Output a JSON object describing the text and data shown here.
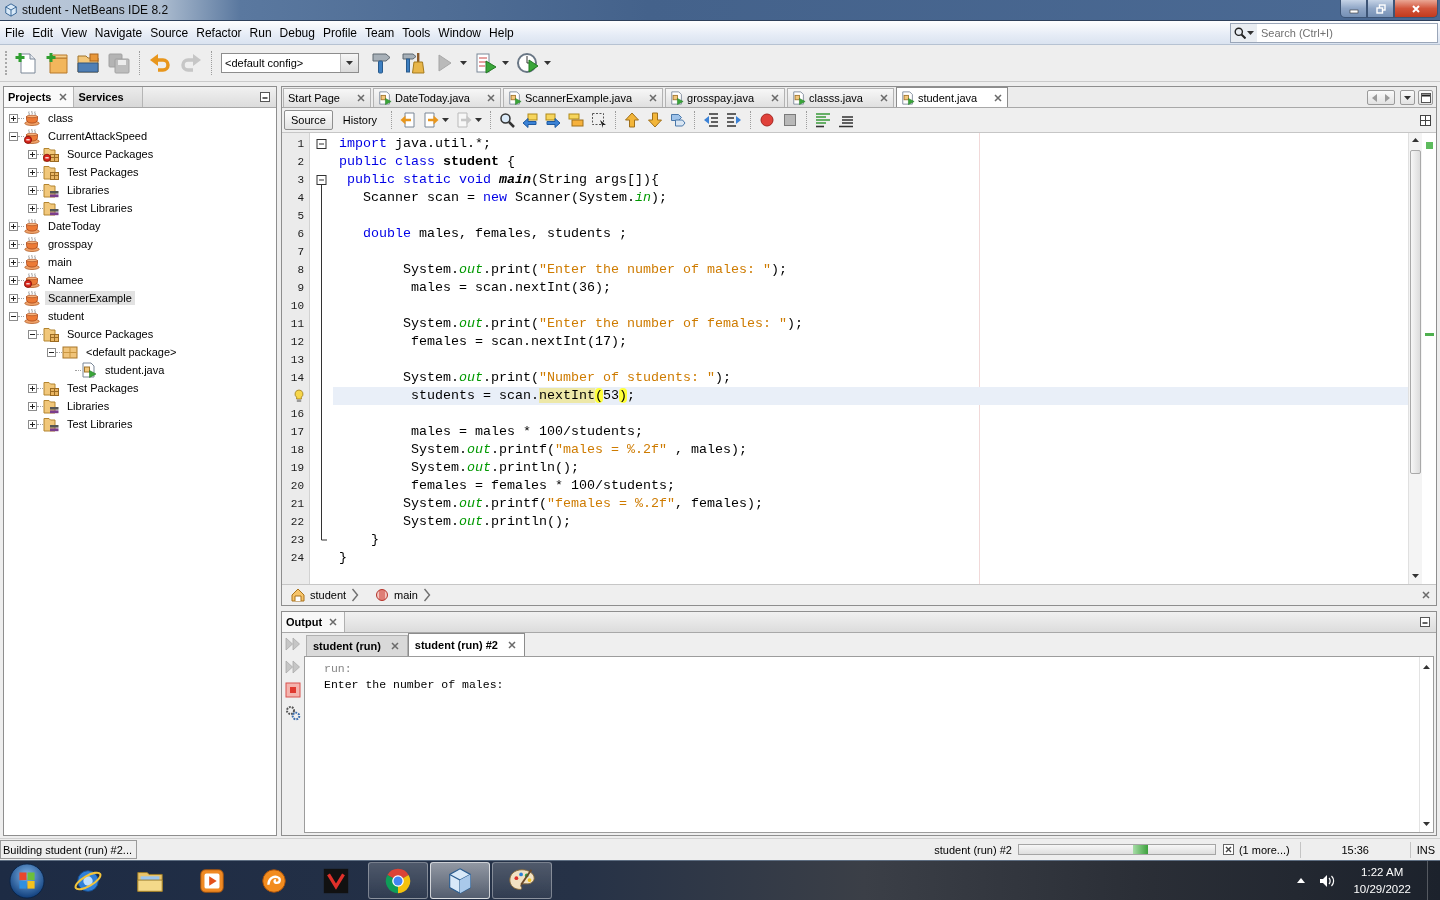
{
  "window": {
    "title": "student - NetBeans IDE 8.2"
  },
  "menu": [
    "File",
    "Edit",
    "View",
    "Navigate",
    "Source",
    "Refactor",
    "Run",
    "Debug",
    "Profile",
    "Team",
    "Tools",
    "Window",
    "Help"
  ],
  "search": {
    "placeholder": "Search (Ctrl+I)"
  },
  "toolbar": {
    "groups": [
      [
        {
          "kind": "new-file",
          "disabled": false
        },
        {
          "kind": "new-project",
          "disabled": false
        },
        {
          "kind": "open-project",
          "disabled": false
        },
        {
          "kind": "save-all",
          "disabled": true
        }
      ],
      [
        {
          "kind": "undo",
          "disabled": false
        },
        {
          "kind": "redo",
          "disabled": true
        }
      ]
    ],
    "config": "<default config>",
    "run_group": [
      {
        "kind": "build",
        "disabled": false,
        "dropdown": false
      },
      {
        "kind": "clean-build",
        "disabled": false,
        "dropdown": false
      },
      {
        "kind": "run",
        "disabled": true,
        "dropdown": true
      },
      {
        "kind": "debug",
        "disabled": false,
        "dropdown": true
      },
      {
        "kind": "profile",
        "disabled": false,
        "dropdown": true
      }
    ]
  },
  "projects": {
    "tabs": [
      {
        "label": "Projects",
        "selected": true
      },
      {
        "label": "Services",
        "selected": false
      }
    ],
    "tree": [
      {
        "label": "class",
        "kind": "project",
        "expanded": false,
        "selected": false,
        "error": false
      },
      {
        "label": "CurrentAttackSpeed",
        "kind": "project",
        "expanded": true,
        "selected": false,
        "error": true,
        "children": [
          {
            "label": "Source Packages",
            "kind": "source-packages",
            "expanded": false,
            "selected": false,
            "error": true
          },
          {
            "label": "Test Packages",
            "kind": "test-packages",
            "expanded": false,
            "selected": false,
            "error": false
          },
          {
            "label": "Libraries",
            "kind": "libraries",
            "expanded": false,
            "selected": false,
            "error": false
          },
          {
            "label": "Test Libraries",
            "kind": "test-libraries",
            "expanded": false,
            "selected": false,
            "error": false
          }
        ]
      },
      {
        "label": "DateToday",
        "kind": "project",
        "expanded": false,
        "selected": false,
        "error": false
      },
      {
        "label": "grosspay",
        "kind": "project",
        "expanded": false,
        "selected": false,
        "error": false
      },
      {
        "label": "main",
        "kind": "project",
        "expanded": false,
        "selected": false,
        "error": false
      },
      {
        "label": "Namee",
        "kind": "project",
        "expanded": false,
        "selected": false,
        "error": true
      },
      {
        "label": "ScannerExample",
        "kind": "project",
        "expanded": false,
        "selected": true,
        "error": false
      },
      {
        "label": "student",
        "kind": "project",
        "expanded": true,
        "selected": false,
        "error": false,
        "children": [
          {
            "label": "Source Packages",
            "kind": "source-packages",
            "expanded": true,
            "selected": false,
            "error": false,
            "children": [
              {
                "label": "<default package>",
                "kind": "package",
                "expanded": true,
                "selected": false,
                "error": false,
                "children": [
                  {
                    "label": "student.java",
                    "kind": "java-file",
                    "selected": false,
                    "error": false
                  }
                ]
              }
            ]
          },
          {
            "label": "Test Packages",
            "kind": "test-packages",
            "expanded": false,
            "selected": false,
            "error": false
          },
          {
            "label": "Libraries",
            "kind": "libraries",
            "expanded": false,
            "selected": false,
            "error": false
          },
          {
            "label": "Test Libraries",
            "kind": "test-libraries",
            "expanded": false,
            "selected": false,
            "error": false
          }
        ]
      }
    ]
  },
  "editor": {
    "tabs": [
      {
        "label": "Start Page",
        "kind": "page",
        "selected": false
      },
      {
        "label": "DateToday.java",
        "kind": "java",
        "selected": false
      },
      {
        "label": "ScannerExample.java",
        "kind": "java",
        "selected": false
      },
      {
        "label": "grosspay.java",
        "kind": "java",
        "selected": false
      },
      {
        "label": "classs.java",
        "kind": "java",
        "selected": false
      },
      {
        "label": "student.java",
        "kind": "java",
        "selected": true
      }
    ],
    "views": [
      {
        "label": "Source",
        "selected": true
      },
      {
        "label": "History",
        "selected": false
      }
    ],
    "tools": [
      [
        {
          "kind": "back",
          "disabled": false,
          "dropdown": false
        },
        {
          "kind": "forward",
          "disabled": false,
          "dropdown": true
        },
        {
          "kind": "last-edit",
          "disabled": true,
          "dropdown": true
        }
      ],
      [
        {
          "kind": "find",
          "disabled": false,
          "dropdown": false
        },
        {
          "kind": "find-prev",
          "disabled": false,
          "dropdown": false
        },
        {
          "kind": "find-next",
          "disabled": false,
          "dropdown": false
        },
        {
          "kind": "highlight",
          "disabled": false,
          "dropdown": false
        },
        {
          "kind": "find-selection",
          "disabled": false,
          "dropdown": false
        }
      ],
      [
        {
          "kind": "bookmark-prev",
          "disabled": false,
          "dropdown": false
        },
        {
          "kind": "bookmark-next",
          "disabled": false,
          "dropdown": false
        },
        {
          "kind": "bookmark-toggle",
          "disabled": false,
          "dropdown": false
        }
      ],
      [
        {
          "kind": "shift-left",
          "disabled": false,
          "dropdown": false
        },
        {
          "kind": "shift-right",
          "disabled": false,
          "dropdown": false
        }
      ],
      [
        {
          "kind": "record",
          "disabled": false,
          "dropdown": false
        },
        {
          "kind": "stop",
          "disabled": false,
          "dropdown": false
        }
      ],
      [
        {
          "kind": "comment",
          "disabled": false,
          "dropdown": false
        },
        {
          "kind": "uncomment",
          "disabled": false,
          "dropdown": false
        }
      ]
    ],
    "lines": [
      {
        "number": "1",
        "hint": false,
        "current": false,
        "expanded": true,
        "tokens": [
          {
            "kind": "keyword",
            "text": "import"
          },
          {
            "kind": "plain",
            "text": " java.util.*;"
          }
        ]
      },
      {
        "number": "2",
        "hint": false,
        "current": false,
        "tokens": [
          {
            "kind": "keyword",
            "text": "public class"
          },
          {
            "kind": "declaration",
            "text": " student"
          },
          {
            "kind": "plain",
            "text": " {"
          }
        ]
      },
      {
        "number": "3",
        "hint": false,
        "current": false,
        "expanded": true,
        "tokens": [
          {
            "kind": "keyword",
            "text": " public static void"
          },
          {
            "kind": "static-method",
            "text": " main"
          },
          {
            "kind": "plain",
            "text": "(String args[]){"
          }
        ],
        "children": [
          {
            "number": "4",
            "hint": false,
            "current": false,
            "tokens": [
              {
                "kind": "plain",
                "text": "   Scanner scan = "
              },
              {
                "kind": "keyword",
                "text": "new"
              },
              {
                "kind": "plain",
                "text": " Scanner(System."
              },
              {
                "kind": "field",
                "text": "in"
              },
              {
                "kind": "plain",
                "text": ");"
              }
            ]
          },
          {
            "number": "5",
            "hint": false,
            "current": false
          },
          {
            "number": "6",
            "hint": false,
            "current": false,
            "tokens": [
              {
                "kind": "keyword",
                "text": "   double"
              },
              {
                "kind": "plain",
                "text": " males, females, students ;"
              }
            ]
          },
          {
            "number": "7",
            "hint": false,
            "current": false
          },
          {
            "number": "8",
            "hint": false,
            "current": false,
            "tokens": [
              {
                "kind": "plain",
                "text": "        System."
              },
              {
                "kind": "field",
                "text": "out"
              },
              {
                "kind": "plain",
                "text": ".print("
              },
              {
                "kind": "string",
                "text": "\"Enter the number of males: \""
              },
              {
                "kind": "plain",
                "text": ");"
              }
            ]
          },
          {
            "number": "9",
            "hint": false,
            "current": false,
            "tokens": [
              {
                "kind": "plain",
                "text": "         males = scan.nextInt(36);"
              }
            ]
          },
          {
            "number": "10",
            "hint": false,
            "current": false
          },
          {
            "number": "11",
            "hint": false,
            "current": false,
            "tokens": [
              {
                "kind": "plain",
                "text": "        System."
              },
              {
                "kind": "field",
                "text": "out"
              },
              {
                "kind": "plain",
                "text": ".print("
              },
              {
                "kind": "string",
                "text": "\"Enter the number of females: \""
              },
              {
                "kind": "plain",
                "text": ");"
              }
            ]
          },
          {
            "number": "12",
            "hint": false,
            "current": false,
            "tokens": [
              {
                "kind": "plain",
                "text": "         females = scan.nextInt(17);"
              }
            ]
          },
          {
            "number": "13",
            "hint": false,
            "current": false
          },
          {
            "number": "14",
            "hint": false,
            "current": false,
            "tokens": [
              {
                "kind": "plain",
                "text": "        System."
              },
              {
                "kind": "field",
                "text": "out"
              },
              {
                "kind": "plain",
                "text": ".print("
              },
              {
                "kind": "string",
                "text": "\"Number of students: \""
              },
              {
                "kind": "plain",
                "text": ");"
              }
            ]
          },
          {
            "hint": true,
            "current": true,
            "tokens": [
              {
                "kind": "plain",
                "text": "         students = scan."
              },
              {
                "kind": "occurrence",
                "text": "nextInt"
              },
              {
                "kind": "bracket",
                "text": "("
              },
              {
                "kind": "plain",
                "text": "53"
              },
              {
                "kind": "bracket",
                "text": ")"
              },
              {
                "kind": "plain",
                "text": ";"
              }
            ]
          },
          {
            "number": "16",
            "hint": false,
            "current": false
          },
          {
            "number": "17",
            "hint": false,
            "current": false,
            "tokens": [
              {
                "kind": "plain",
                "text": "         males = males * 100/students;"
              }
            ]
          },
          {
            "number": "18",
            "hint": false,
            "current": false,
            "tokens": [
              {
                "kind": "plain",
                "text": "         System."
              },
              {
                "kind": "field",
                "text": "out"
              },
              {
                "kind": "plain",
                "text": ".printf("
              },
              {
                "kind": "string",
                "text": "\"males = %.2f\""
              },
              {
                "kind": "plain",
                "text": " , males);"
              }
            ]
          },
          {
            "number": "19",
            "hint": false,
            "current": false,
            "tokens": [
              {
                "kind": "plain",
                "text": "         System."
              },
              {
                "kind": "field",
                "text": "out"
              },
              {
                "kind": "plain",
                "text": ".println();"
              }
            ]
          },
          {
            "number": "20",
            "hint": false,
            "current": false,
            "tokens": [
              {
                "kind": "plain",
                "text": "         females = females * 100/students;"
              }
            ]
          },
          {
            "number": "21",
            "hint": false,
            "current": false,
            "tokens": [
              {
                "kind": "plain",
                "text": "        System."
              },
              {
                "kind": "field",
                "text": "out"
              },
              {
                "kind": "plain",
                "text": ".printf("
              },
              {
                "kind": "string",
                "text": "\"females = %.2f\""
              },
              {
                "kind": "plain",
                "text": ", females);"
              }
            ]
          },
          {
            "number": "22",
            "hint": false,
            "current": false,
            "tokens": [
              {
                "kind": "plain",
                "text": "        System."
              },
              {
                "kind": "field",
                "text": "out"
              },
              {
                "kind": "plain",
                "text": ".println();"
              }
            ]
          },
          {
            "number": "23",
            "hint": false,
            "current": false,
            "tokens": [
              {
                "kind": "plain",
                "text": "    }"
              }
            ]
          }
        ]
      },
      {
        "number": "24",
        "hint": false,
        "current": false,
        "tokens": [
          {
            "kind": "plain",
            "text": "}"
          }
        ]
      }
    ],
    "breadcrumb": [
      {
        "label": "student",
        "kind": "class"
      },
      {
        "label": "main",
        "kind": "method"
      }
    ]
  },
  "output": {
    "title": "Output",
    "tools": [
      {
        "kind": "rerun",
        "disabled": true
      },
      {
        "kind": "rerun-options",
        "disabled": true
      },
      {
        "kind": "stop",
        "disabled": false
      },
      {
        "kind": "settings",
        "disabled": false
      }
    ],
    "tabs": [
      {
        "label": "student (run)",
        "selected": false
      },
      {
        "label": "student (run) #2",
        "selected": true
      }
    ],
    "lines": [
      {
        "kind": "info",
        "text": "run:"
      },
      {
        "kind": "output",
        "text": "Enter the number of males:"
      }
    ]
  },
  "status_bar": {
    "message": "Building student (run) #2...",
    "task": "student (run) #2",
    "progress": {
      "indeterminate": true
    },
    "more": "(1 more...)",
    "position": "15:36",
    "mode": "INS"
  },
  "taskbar": {
    "apps": [
      {
        "kind": "browser",
        "running": false,
        "selected": false
      },
      {
        "kind": "explorer",
        "running": false,
        "selected": false
      },
      {
        "kind": "media",
        "running": false,
        "selected": false
      },
      {
        "kind": "squirrel",
        "running": false,
        "selected": false
      },
      {
        "kind": "v-tile",
        "running": false,
        "selected": false
      },
      {
        "kind": "ring",
        "running": true,
        "selected": false
      },
      {
        "kind": "cube",
        "running": true,
        "selected": true
      },
      {
        "kind": "palette",
        "running": true,
        "selected": false
      }
    ],
    "time": "1:22 AM",
    "date": "10/29/2022"
  }
}
